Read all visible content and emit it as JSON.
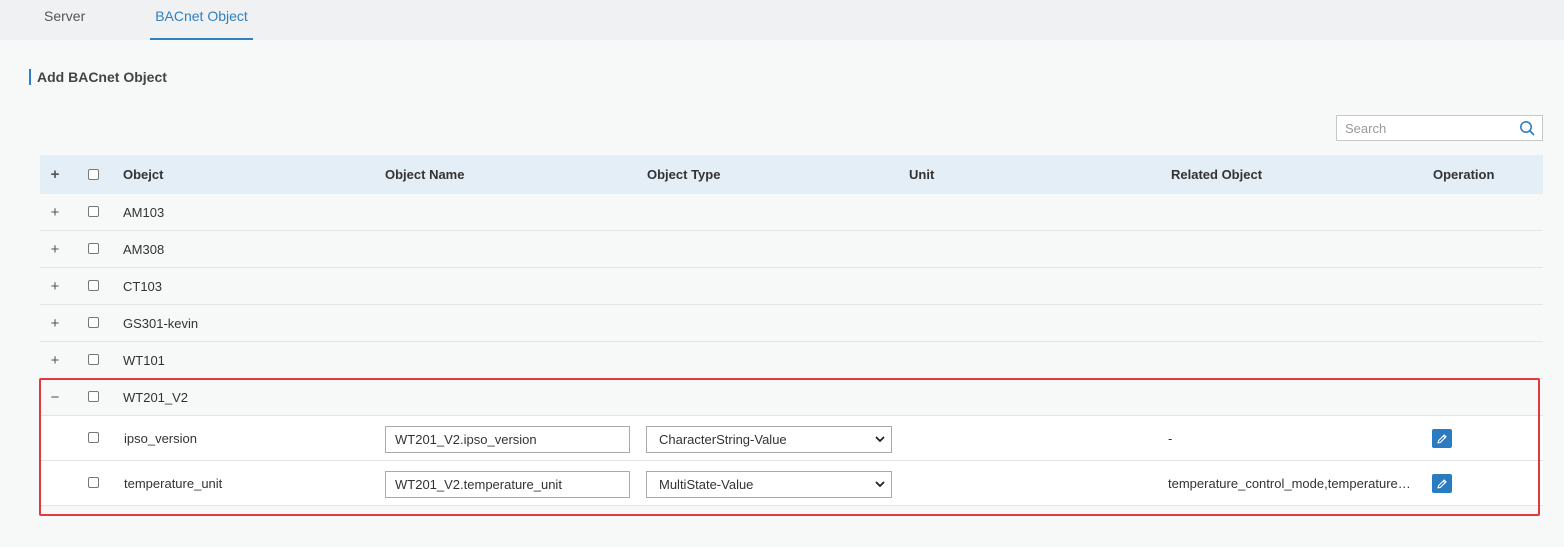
{
  "tabs": [
    {
      "label": "Server",
      "active": false
    },
    {
      "label": "BACnet Object",
      "active": true
    }
  ],
  "section": {
    "title": "Add BACnet Object"
  },
  "search": {
    "placeholder": "Search",
    "value": ""
  },
  "table": {
    "headers": {
      "expand": "+",
      "object": "Obejct",
      "object_name": "Object Name",
      "object_type": "Object Type",
      "unit": "Unit",
      "related_object": "Related Object",
      "operation": "Operation"
    },
    "groups": [
      {
        "label": "AM103",
        "expander": "+"
      },
      {
        "label": "AM308",
        "expander": "+"
      },
      {
        "label": "CT103",
        "expander": "+"
      },
      {
        "label": "GS301-kevin",
        "expander": "+"
      },
      {
        "label": "WT101",
        "expander": "+"
      },
      {
        "label": "WT201_V2",
        "expander": "−"
      }
    ],
    "children": [
      {
        "object": "ipso_version",
        "object_name": "WT201_V2.ipso_version",
        "object_type": "CharacterString-Value",
        "unit": "",
        "related_object": "-"
      },
      {
        "object": "temperature_unit",
        "object_name": "WT201_V2.temperature_unit",
        "object_type": "MultiState-Value",
        "unit": "",
        "related_object": "temperature_control_mode,temperature_target_value,temperature"
      }
    ]
  },
  "colors": {
    "accent": "#2f80c3",
    "header_bg": "#e4eef7",
    "highlight": "#e0393e",
    "edit_button": "#2a7bc0"
  },
  "icons": {
    "search": "search-icon",
    "edit": "pencil-icon",
    "dropdown": "chevron-down-icon"
  }
}
